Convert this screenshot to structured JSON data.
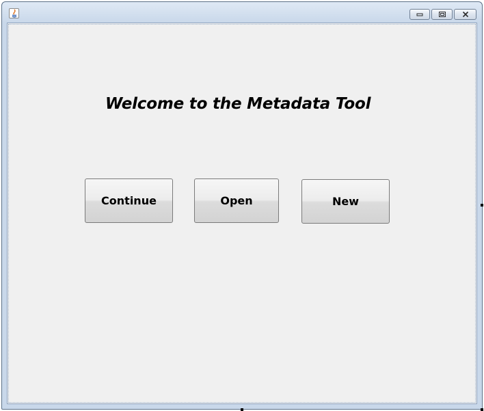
{
  "window": {
    "controls": {
      "minimize_icon": "minimize-icon",
      "maximize_icon": "maximize-icon",
      "close_icon": "close-icon"
    }
  },
  "main": {
    "welcome_text": "Welcome to the Metadata Tool",
    "buttons": {
      "continue_label": "Continue",
      "open_label": "Open",
      "new_label": "New"
    }
  },
  "colors": {
    "titlebar": "#c9d8ea",
    "client_background": "#f0f0f0",
    "button_border": "#7a7a7a"
  }
}
